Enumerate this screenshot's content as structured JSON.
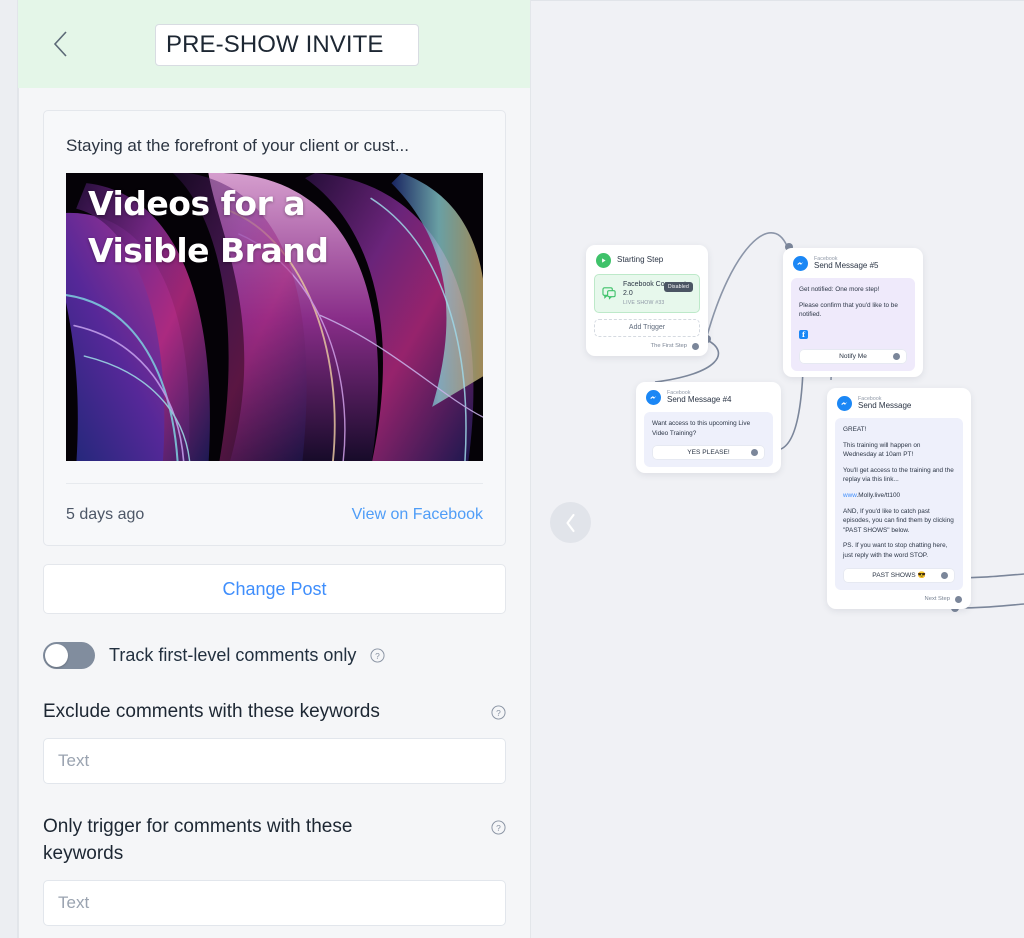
{
  "header": {
    "back_icon": "chevron-left-icon",
    "title_value": "PRE-SHOW INVITE"
  },
  "post": {
    "text": "Staying at the forefront of your client or cust...",
    "image_title": "Videos for a\nVisible Brand",
    "date": "5 days ago",
    "view_link": "View on Facebook",
    "change_post_label": "Change Post"
  },
  "settings": {
    "track_toggle_label": "Track first-level comments only",
    "track_toggle_on": false,
    "exclude_label": "Exclude comments with these keywords",
    "exclude_value": "",
    "exclude_placeholder": "Text",
    "only_trigger_label": "Only trigger for comments with these keywords",
    "only_trigger_value": "",
    "only_trigger_placeholder": "Text",
    "help_icon": "question-circle-icon"
  },
  "canvas": {
    "collapse_icon": "chevron-left-icon",
    "nodes": {
      "start": {
        "title": "Starting Step",
        "trigger_name": "Facebook Comments 2.0",
        "trigger_sub": "LIVE SHOW #33",
        "trigger_status": "Disabled",
        "trigger_icon": "facebook-comments-icon",
        "add_trigger_label": "Add Trigger",
        "foot_label": "The First Step"
      },
      "msg5": {
        "kicker": "Facebook",
        "title": "Send Message #5",
        "lines": [
          "Get notified: One more step!",
          "Please confirm that you'd like to be notified."
        ],
        "button_label": "Notify Me"
      },
      "msg4": {
        "kicker": "Facebook",
        "title": "Send Message #4",
        "lines": [
          "Want access to this upcoming Live Video Training?"
        ],
        "button_label": "YES PLEASE!"
      },
      "msg": {
        "kicker": "Facebook",
        "title": "Send Message",
        "lines": [
          "GREAT!",
          "This training will happen on Wednesday at 10am PT!",
          "You'll get access to the training and the replay via this link...",
          "www.Molly.live/tt100",
          "AND, If you'd like to catch past episodes, you can find them by clicking \"PAST SHOWS\" below.",
          "PS. If you want to stop chatting here, just reply with the word STOP."
        ],
        "link_prefix": "www",
        "link_suffix": ".Molly.live/tt100",
        "button_label": "PAST SHOWS 😎",
        "foot_label": "Next Step"
      }
    }
  },
  "colors": {
    "header_green": "#e4f6e8",
    "link_blue": "#4f9df7",
    "canvas_bg": "#f0f1f5",
    "panel_bg": "#f5f6f8",
    "toggle_off": "#818d9e"
  }
}
